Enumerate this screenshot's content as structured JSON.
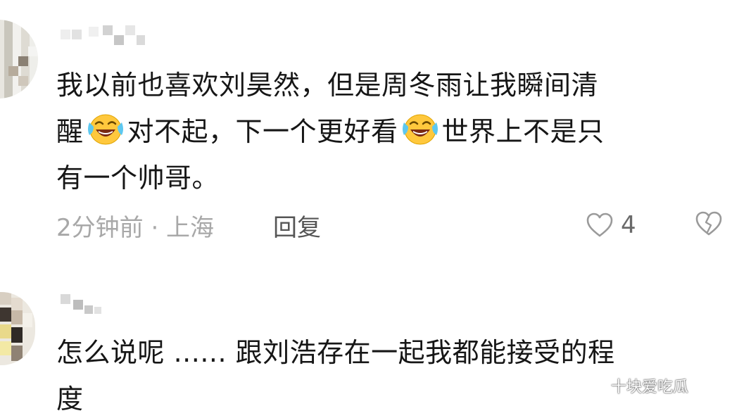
{
  "comments": [
    {
      "lines": [
        "我以前也喜欢刘昊然，但是周冬雨让我瞬间清",
        [
          "醒",
          "emoji",
          "对不起，下一个更好看",
          "emoji",
          "世界上不是只"
        ],
        "有一个帅哥。"
      ],
      "line1": "我以前也喜欢刘昊然，但是周冬雨让我瞬间清",
      "line2_a": "醒",
      "line2_b": "对不起，下一个更好看",
      "line2_c": "世界上不是只",
      "line3": "有一个帅哥。",
      "time_location": "2分钟前 · 上海",
      "reply_label": "回复",
      "like_count": "4",
      "emoji_name": "laughing-with-tears-emoji"
    },
    {
      "line1": "怎么说呢 ...... 跟刘浩存在一起我都能接受的程",
      "line2": "度"
    }
  ],
  "watermark": {
    "text": "十块爱吃瓜",
    "icon": "wechat-icon"
  },
  "colors": {
    "text": "#161616",
    "meta": "#a8a8a8",
    "icon": "#9a9a9a",
    "background": "#ffffff"
  }
}
